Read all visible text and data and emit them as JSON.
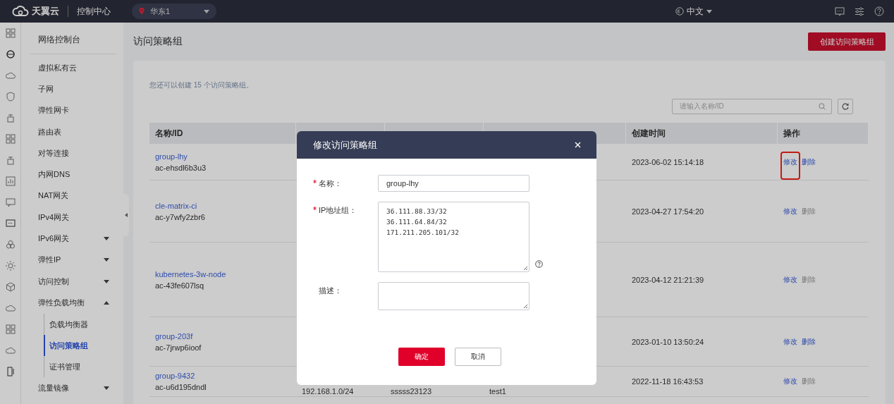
{
  "header": {
    "logo": "天翼云",
    "console": "控制中心",
    "region": "华东1",
    "language": "中文"
  },
  "sidebar": {
    "title": "网络控制台",
    "items": [
      {
        "label": "虚拟私有云",
        "selected": false
      },
      {
        "label": "子网",
        "selected": false
      },
      {
        "label": "弹性网卡",
        "selected": false
      },
      {
        "label": "路由表",
        "selected": false
      },
      {
        "label": "对等连接",
        "selected": false
      },
      {
        "label": "内网DNS",
        "selected": false
      },
      {
        "label": "NAT网关",
        "selected": false
      },
      {
        "label": "IPv4网关",
        "selected": false
      },
      {
        "label": "IPv6网关",
        "selected": false,
        "expanded": false
      },
      {
        "label": "弹性IP",
        "selected": false,
        "expanded": false
      },
      {
        "label": "访问控制",
        "selected": false,
        "expanded": false
      },
      {
        "label": "弹性负载均衡",
        "selected": false,
        "expanded": true,
        "children": [
          {
            "label": "负载均衡器",
            "selected": false
          },
          {
            "label": "访问策略组",
            "selected": true
          },
          {
            "label": "证书管理",
            "selected": false
          }
        ]
      },
      {
        "label": "流量镜像",
        "selected": false,
        "expanded": false
      }
    ]
  },
  "page": {
    "title": "访问策略组",
    "create_button": "创建访问策略组",
    "quota_hint": "您还可以创建 15 个访问策略组。",
    "search": {
      "placeholder": "请输入名称/ID"
    }
  },
  "table": {
    "columns": [
      "名称/ID",
      "创建时间",
      "操作"
    ],
    "rows": [
      {
        "name": "group-lhy",
        "id": "ac-ehsdl6b3u3",
        "created": "2023-06-02 15:14:18",
        "actions": [
          {
            "label": "修改",
            "disabled": false,
            "highlighted": true
          },
          {
            "label": "删除",
            "disabled": false,
            "highlighted": false
          }
        ]
      },
      {
        "name": "cle-matrix-ci",
        "id": "ac-y7wfy2zbr6",
        "created": "2023-04-27 17:54:20",
        "actions": [
          {
            "label": "修改",
            "disabled": false,
            "highlighted": false
          },
          {
            "label": "删除",
            "disabled": true,
            "highlighted": false
          }
        ]
      },
      {
        "name": "kubernetes-3w-node",
        "id": "ac-43fe607lsq",
        "created": "2023-04-12 21:21:39",
        "actions": [
          {
            "label": "修改",
            "disabled": false,
            "highlighted": false
          },
          {
            "label": "删除",
            "disabled": true,
            "highlighted": false
          }
        ]
      },
      {
        "name": "group-203f",
        "id": "ac-7jrwp6ioof",
        "created": "2023-01-10 13:50:24",
        "actions": [
          {
            "label": "修改",
            "disabled": false,
            "highlighted": false
          },
          {
            "label": "删除",
            "disabled": false,
            "highlighted": false
          }
        ]
      },
      {
        "name": "group-9432",
        "id": "ac-u6d195dndl",
        "created": "2022-11-18 16:43:53",
        "partial_cells": [
          "192.168.1.0/24",
          "sssss23123",
          "test1"
        ],
        "actions": [
          {
            "label": "修改",
            "disabled": false,
            "highlighted": false
          },
          {
            "label": "删除",
            "disabled": true,
            "highlighted": false
          }
        ]
      }
    ]
  },
  "dialog": {
    "title": "修改访问策略组",
    "fields": [
      {
        "label": "名称：",
        "required": true,
        "kind": "input",
        "value": "group-lhy",
        "help": false
      },
      {
        "label": "IP地址组：",
        "required": true,
        "kind": "textarea",
        "value": "36.111.88.33/32\n36.111.64.84/32\n171.211.205.101/32",
        "help": true
      },
      {
        "label": "描述：",
        "required": false,
        "kind": "textarea",
        "help": false
      }
    ],
    "buttons": [
      {
        "label": "确定",
        "kind": "primary"
      },
      {
        "label": "取消",
        "kind": "secondary"
      }
    ]
  }
}
